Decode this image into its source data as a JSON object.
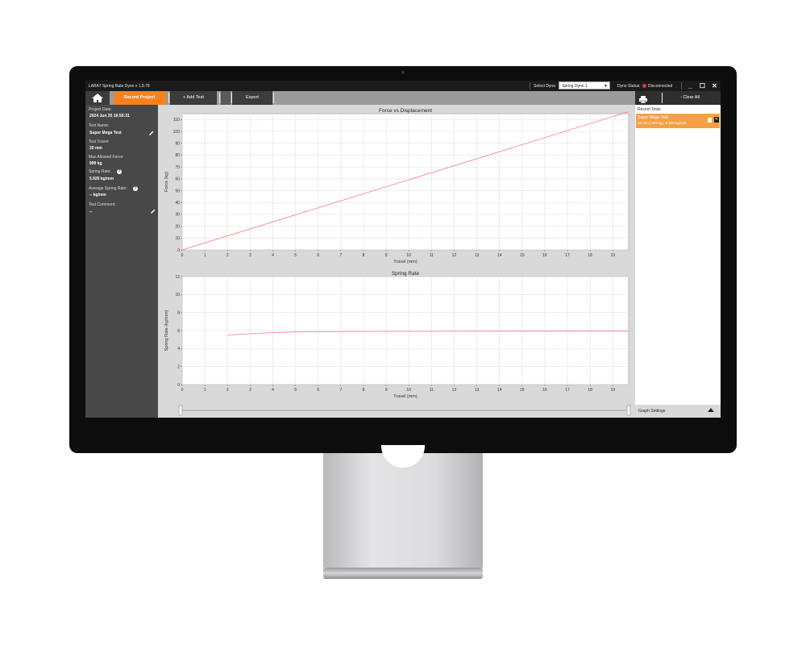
{
  "window": {
    "title": "LABA7 Spring Rate Dyno v 1.9.78",
    "select_dyno_label": "Select Dyno:",
    "select_dyno_value": "Spring Dyno 1",
    "dyno_status_label": "Dyno Status:",
    "dyno_status_value": "Disconnected",
    "status_color": "#e53935",
    "minimize": "_",
    "maximize": "☐",
    "close": "✕"
  },
  "toolbar": {
    "home_icon": "home-icon",
    "recent_project": "Recent Project",
    "add_test": "+ Add Test",
    "export": "Export",
    "print_icon": "printer-icon",
    "clear_all": "- Clear All",
    "accent": "#f5821f"
  },
  "sidebar": {
    "project_date_label": "Project Date:",
    "project_date_value": "2024 Jun 25 10:50:31",
    "test_name_label": "Test Name:",
    "test_name_value": "Super Mega Test",
    "test_travel_label": "Test Travel:",
    "test_travel_value": "20 mm",
    "max_force_label": "Max Allowed Force:",
    "max_force_value": "999 kg",
    "spring_rate_label": "Spring Rate:",
    "spring_rate_value": "5.926 kg/mm",
    "avg_spring_rate_label": "Average Spring Rate:",
    "avg_spring_rate_value": "-- kg/mm",
    "test_comment_label": "Test Comment:",
    "test_comment_value": "--"
  },
  "recent_tests": {
    "title": "Recent Tests",
    "items": [
      {
        "name": "Super Mega Test",
        "detail": "20 mm | 999 kg | 5.926 kg/mm"
      }
    ],
    "graph_settings": "Graph Settings"
  },
  "chart_data": [
    {
      "type": "line",
      "title": "Force vs Displacement",
      "xlabel": "Travel (mm)",
      "ylabel": "Force (kg)",
      "xlim": [
        0,
        19.7
      ],
      "ylim": [
        0,
        115
      ],
      "xticks": [
        "0",
        "1",
        "2",
        "3",
        "4",
        "5",
        "6",
        "7",
        "8",
        "9",
        "10",
        "11",
        "12",
        "13",
        "14",
        "15",
        "16",
        "17",
        "18",
        "19"
      ],
      "yticks": [
        "0",
        "10",
        "20",
        "30",
        "40",
        "50",
        "60",
        "70",
        "80",
        "90",
        "100",
        "110"
      ],
      "series": [
        {
          "color": "#f08080",
          "x": [
            0,
            19.7
          ],
          "y": [
            0,
            116.7
          ]
        }
      ],
      "grid": true
    },
    {
      "type": "line",
      "title": "Spring Rate",
      "xlabel": "Travel (mm)",
      "ylabel": "Spring Rate (kg/mm)",
      "xlim": [
        0,
        19.7
      ],
      "ylim": [
        0,
        12
      ],
      "xticks": [
        "0",
        "1",
        "2",
        "3",
        "4",
        "5",
        "6",
        "7",
        "8",
        "9",
        "10",
        "11",
        "12",
        "13",
        "14",
        "15",
        "16",
        "17",
        "18",
        "19"
      ],
      "yticks": [
        "0",
        "2",
        "4",
        "6",
        "8",
        "10",
        "12"
      ],
      "series": [
        {
          "color": "#f08080",
          "x": [
            2,
            3,
            4,
            5,
            6,
            8,
            10,
            12,
            15,
            19.7
          ],
          "y": [
            5.5,
            5.65,
            5.78,
            5.85,
            5.88,
            5.9,
            5.91,
            5.92,
            5.925,
            5.926
          ]
        }
      ],
      "grid": true
    }
  ]
}
